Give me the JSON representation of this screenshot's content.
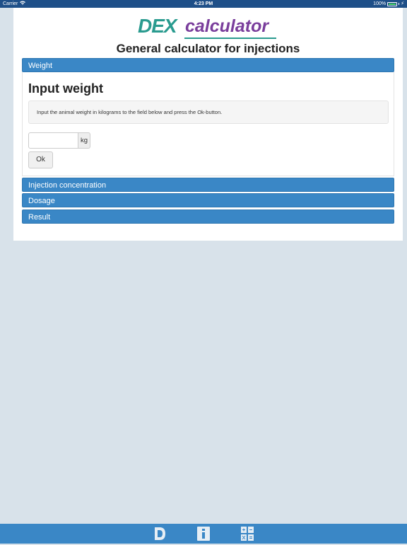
{
  "status_bar": {
    "carrier": "Carrier",
    "time": "4:23 PM",
    "battery": "100%"
  },
  "logo": {
    "part1": "DEX",
    "part2": "calculator"
  },
  "app_title": "General calculator for injections",
  "sections": {
    "weight": "Weight",
    "injection_concentration": "Injection concentration",
    "dosage": "Dosage",
    "result": "Result"
  },
  "weight_panel": {
    "heading": "Input weight",
    "instruction": "Input the animal weight in kilograms to the field below and press the Ok-button.",
    "input_value": "",
    "unit": "kg",
    "ok_label": "Ok"
  },
  "tab_bar": {
    "icons": [
      "dex-logo-icon",
      "info-icon",
      "calculator-icon"
    ]
  },
  "colors": {
    "status_bar": "#1e4f88",
    "accent": "#3a87c6",
    "logo_teal": "#2a9b8f",
    "logo_purple": "#7a3e9c",
    "background": "#d8e2ea"
  }
}
